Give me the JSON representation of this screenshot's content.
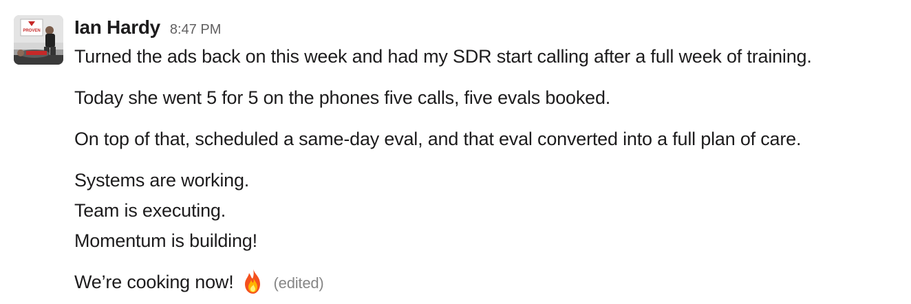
{
  "message": {
    "sender": "Ian Hardy",
    "timestamp": "8:47 PM",
    "avatar_text": "PROVEN",
    "avatar_logo": "proven-logo-icon",
    "paragraphs": [
      "Turned the ads back on this week and had my SDR start calling after a full week of training.",
      "Today she went 5 for 5 on the phones five calls, five evals booked.",
      "On top of that, scheduled a same-day eval, and that eval converted into a full plan of care."
    ],
    "lines": [
      "Systems are working.",
      "Team is executing.",
      "Momentum is building!"
    ],
    "final_line": "We’re cooking now!",
    "emoji": "fire-icon",
    "edited_label": "(edited)"
  }
}
